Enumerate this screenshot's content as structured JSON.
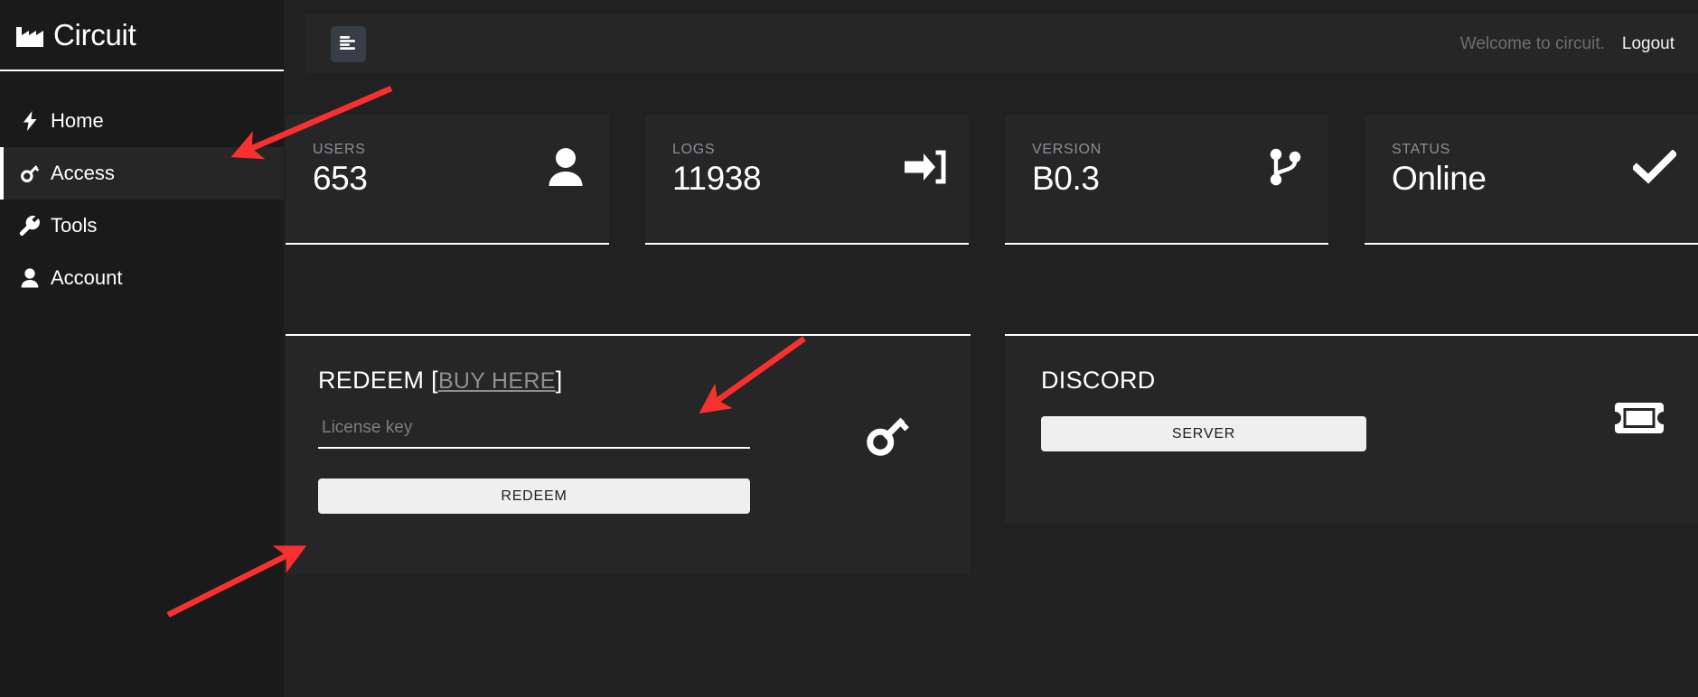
{
  "sidebar": {
    "brand": {
      "label": "Circuit",
      "icon": "factory-icon"
    },
    "items": [
      {
        "label": "Home",
        "icon": "bolt-icon",
        "active": false
      },
      {
        "label": "Access",
        "icon": "key-icon",
        "active": true
      },
      {
        "label": "Tools",
        "icon": "wrench-icon",
        "active": false
      },
      {
        "label": "Account",
        "icon": "person-icon",
        "active": false
      }
    ]
  },
  "topbar": {
    "menu_icon": "align-left-icon",
    "welcome": "Welcome to circuit.",
    "logout": "Logout"
  },
  "stats": [
    {
      "label": "USERS",
      "value": "653",
      "icon": "person-icon"
    },
    {
      "label": "LOGS",
      "value": "11938",
      "icon": "sign-in-icon"
    },
    {
      "label": "VERSION",
      "value": "B0.3",
      "icon": "code-branch-icon"
    },
    {
      "label": "STATUS",
      "value": "Online",
      "icon": "check-icon"
    }
  ],
  "redeem": {
    "title": "REDEEM",
    "bracket_open": "[",
    "link_label": "BUY HERE",
    "bracket_close": "]",
    "placeholder": "License key",
    "input_value": "",
    "button_label": "REDEEM",
    "icon": "key-icon"
  },
  "discord": {
    "title": "DISCORD",
    "button_label": "SERVER",
    "icon": "ticket-icon"
  },
  "colors": {
    "background": "#212121",
    "sidebar": "#1a1a1a",
    "card": "#262626",
    "accent": "#ffffff",
    "muted": "#8a8f96",
    "annotation": "#f8302f",
    "menu_button": "#383d47"
  }
}
